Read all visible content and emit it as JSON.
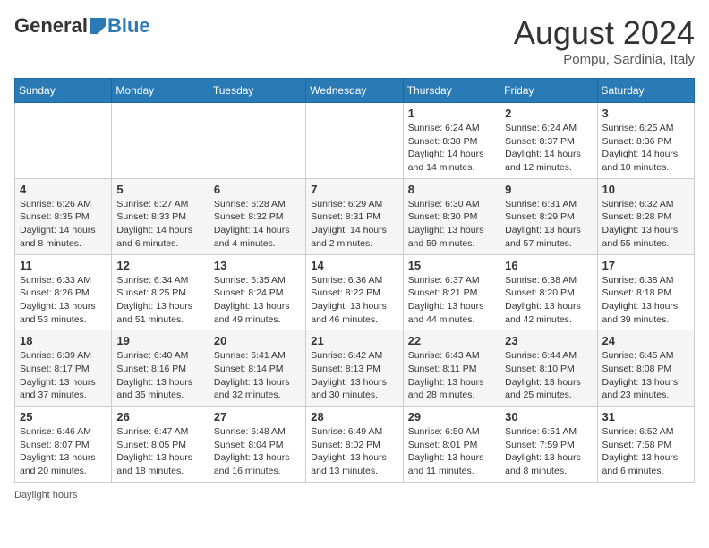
{
  "header": {
    "logo_general": "General",
    "logo_blue": "Blue",
    "month_year": "August 2024",
    "location": "Pompu, Sardinia, Italy"
  },
  "days_of_week": [
    "Sunday",
    "Monday",
    "Tuesday",
    "Wednesday",
    "Thursday",
    "Friday",
    "Saturday"
  ],
  "weeks": [
    [
      {
        "day": "",
        "detail": ""
      },
      {
        "day": "",
        "detail": ""
      },
      {
        "day": "",
        "detail": ""
      },
      {
        "day": "",
        "detail": ""
      },
      {
        "day": "1",
        "detail": "Sunrise: 6:24 AM\nSunset: 8:38 PM\nDaylight: 14 hours and 14 minutes."
      },
      {
        "day": "2",
        "detail": "Sunrise: 6:24 AM\nSunset: 8:37 PM\nDaylight: 14 hours and 12 minutes."
      },
      {
        "day": "3",
        "detail": "Sunrise: 6:25 AM\nSunset: 8:36 PM\nDaylight: 14 hours and 10 minutes."
      }
    ],
    [
      {
        "day": "4",
        "detail": "Sunrise: 6:26 AM\nSunset: 8:35 PM\nDaylight: 14 hours and 8 minutes."
      },
      {
        "day": "5",
        "detail": "Sunrise: 6:27 AM\nSunset: 8:33 PM\nDaylight: 14 hours and 6 minutes."
      },
      {
        "day": "6",
        "detail": "Sunrise: 6:28 AM\nSunset: 8:32 PM\nDaylight: 14 hours and 4 minutes."
      },
      {
        "day": "7",
        "detail": "Sunrise: 6:29 AM\nSunset: 8:31 PM\nDaylight: 14 hours and 2 minutes."
      },
      {
        "day": "8",
        "detail": "Sunrise: 6:30 AM\nSunset: 8:30 PM\nDaylight: 13 hours and 59 minutes."
      },
      {
        "day": "9",
        "detail": "Sunrise: 6:31 AM\nSunset: 8:29 PM\nDaylight: 13 hours and 57 minutes."
      },
      {
        "day": "10",
        "detail": "Sunrise: 6:32 AM\nSunset: 8:28 PM\nDaylight: 13 hours and 55 minutes."
      }
    ],
    [
      {
        "day": "11",
        "detail": "Sunrise: 6:33 AM\nSunset: 8:26 PM\nDaylight: 13 hours and 53 minutes."
      },
      {
        "day": "12",
        "detail": "Sunrise: 6:34 AM\nSunset: 8:25 PM\nDaylight: 13 hours and 51 minutes."
      },
      {
        "day": "13",
        "detail": "Sunrise: 6:35 AM\nSunset: 8:24 PM\nDaylight: 13 hours and 49 minutes."
      },
      {
        "day": "14",
        "detail": "Sunrise: 6:36 AM\nSunset: 8:22 PM\nDaylight: 13 hours and 46 minutes."
      },
      {
        "day": "15",
        "detail": "Sunrise: 6:37 AM\nSunset: 8:21 PM\nDaylight: 13 hours and 44 minutes."
      },
      {
        "day": "16",
        "detail": "Sunrise: 6:38 AM\nSunset: 8:20 PM\nDaylight: 13 hours and 42 minutes."
      },
      {
        "day": "17",
        "detail": "Sunrise: 6:38 AM\nSunset: 8:18 PM\nDaylight: 13 hours and 39 minutes."
      }
    ],
    [
      {
        "day": "18",
        "detail": "Sunrise: 6:39 AM\nSunset: 8:17 PM\nDaylight: 13 hours and 37 minutes."
      },
      {
        "day": "19",
        "detail": "Sunrise: 6:40 AM\nSunset: 8:16 PM\nDaylight: 13 hours and 35 minutes."
      },
      {
        "day": "20",
        "detail": "Sunrise: 6:41 AM\nSunset: 8:14 PM\nDaylight: 13 hours and 32 minutes."
      },
      {
        "day": "21",
        "detail": "Sunrise: 6:42 AM\nSunset: 8:13 PM\nDaylight: 13 hours and 30 minutes."
      },
      {
        "day": "22",
        "detail": "Sunrise: 6:43 AM\nSunset: 8:11 PM\nDaylight: 13 hours and 28 minutes."
      },
      {
        "day": "23",
        "detail": "Sunrise: 6:44 AM\nSunset: 8:10 PM\nDaylight: 13 hours and 25 minutes."
      },
      {
        "day": "24",
        "detail": "Sunrise: 6:45 AM\nSunset: 8:08 PM\nDaylight: 13 hours and 23 minutes."
      }
    ],
    [
      {
        "day": "25",
        "detail": "Sunrise: 6:46 AM\nSunset: 8:07 PM\nDaylight: 13 hours and 20 minutes."
      },
      {
        "day": "26",
        "detail": "Sunrise: 6:47 AM\nSunset: 8:05 PM\nDaylight: 13 hours and 18 minutes."
      },
      {
        "day": "27",
        "detail": "Sunrise: 6:48 AM\nSunset: 8:04 PM\nDaylight: 13 hours and 16 minutes."
      },
      {
        "day": "28",
        "detail": "Sunrise: 6:49 AM\nSunset: 8:02 PM\nDaylight: 13 hours and 13 minutes."
      },
      {
        "day": "29",
        "detail": "Sunrise: 6:50 AM\nSunset: 8:01 PM\nDaylight: 13 hours and 11 minutes."
      },
      {
        "day": "30",
        "detail": "Sunrise: 6:51 AM\nSunset: 7:59 PM\nDaylight: 13 hours and 8 minutes."
      },
      {
        "day": "31",
        "detail": "Sunrise: 6:52 AM\nSunset: 7:58 PM\nDaylight: 13 hours and 6 minutes."
      }
    ]
  ],
  "footer": {
    "daylight_hours_label": "Daylight hours"
  }
}
